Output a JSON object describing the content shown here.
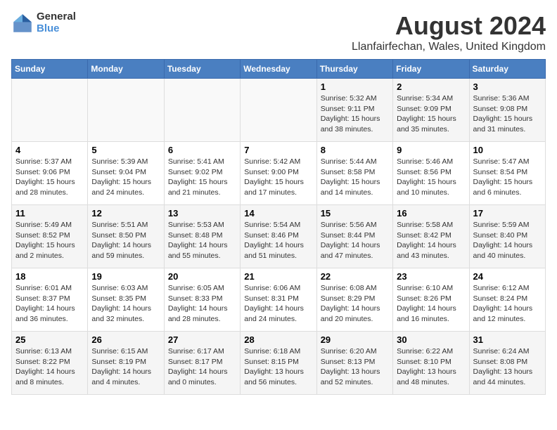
{
  "logo": {
    "general": "General",
    "blue": "Blue"
  },
  "title": "August 2024",
  "subtitle": "Llanfairfechan, Wales, United Kingdom",
  "days_of_week": [
    "Sunday",
    "Monday",
    "Tuesday",
    "Wednesday",
    "Thursday",
    "Friday",
    "Saturday"
  ],
  "weeks": [
    [
      {
        "day": "",
        "info": ""
      },
      {
        "day": "",
        "info": ""
      },
      {
        "day": "",
        "info": ""
      },
      {
        "day": "",
        "info": ""
      },
      {
        "day": "1",
        "info": "Sunrise: 5:32 AM\nSunset: 9:11 PM\nDaylight: 15 hours\nand 38 minutes."
      },
      {
        "day": "2",
        "info": "Sunrise: 5:34 AM\nSunset: 9:09 PM\nDaylight: 15 hours\nand 35 minutes."
      },
      {
        "day": "3",
        "info": "Sunrise: 5:36 AM\nSunset: 9:08 PM\nDaylight: 15 hours\nand 31 minutes."
      }
    ],
    [
      {
        "day": "4",
        "info": "Sunrise: 5:37 AM\nSunset: 9:06 PM\nDaylight: 15 hours\nand 28 minutes."
      },
      {
        "day": "5",
        "info": "Sunrise: 5:39 AM\nSunset: 9:04 PM\nDaylight: 15 hours\nand 24 minutes."
      },
      {
        "day": "6",
        "info": "Sunrise: 5:41 AM\nSunset: 9:02 PM\nDaylight: 15 hours\nand 21 minutes."
      },
      {
        "day": "7",
        "info": "Sunrise: 5:42 AM\nSunset: 9:00 PM\nDaylight: 15 hours\nand 17 minutes."
      },
      {
        "day": "8",
        "info": "Sunrise: 5:44 AM\nSunset: 8:58 PM\nDaylight: 15 hours\nand 14 minutes."
      },
      {
        "day": "9",
        "info": "Sunrise: 5:46 AM\nSunset: 8:56 PM\nDaylight: 15 hours\nand 10 minutes."
      },
      {
        "day": "10",
        "info": "Sunrise: 5:47 AM\nSunset: 8:54 PM\nDaylight: 15 hours\nand 6 minutes."
      }
    ],
    [
      {
        "day": "11",
        "info": "Sunrise: 5:49 AM\nSunset: 8:52 PM\nDaylight: 15 hours\nand 2 minutes."
      },
      {
        "day": "12",
        "info": "Sunrise: 5:51 AM\nSunset: 8:50 PM\nDaylight: 14 hours\nand 59 minutes."
      },
      {
        "day": "13",
        "info": "Sunrise: 5:53 AM\nSunset: 8:48 PM\nDaylight: 14 hours\nand 55 minutes."
      },
      {
        "day": "14",
        "info": "Sunrise: 5:54 AM\nSunset: 8:46 PM\nDaylight: 14 hours\nand 51 minutes."
      },
      {
        "day": "15",
        "info": "Sunrise: 5:56 AM\nSunset: 8:44 PM\nDaylight: 14 hours\nand 47 minutes."
      },
      {
        "day": "16",
        "info": "Sunrise: 5:58 AM\nSunset: 8:42 PM\nDaylight: 14 hours\nand 43 minutes."
      },
      {
        "day": "17",
        "info": "Sunrise: 5:59 AM\nSunset: 8:40 PM\nDaylight: 14 hours\nand 40 minutes."
      }
    ],
    [
      {
        "day": "18",
        "info": "Sunrise: 6:01 AM\nSunset: 8:37 PM\nDaylight: 14 hours\nand 36 minutes."
      },
      {
        "day": "19",
        "info": "Sunrise: 6:03 AM\nSunset: 8:35 PM\nDaylight: 14 hours\nand 32 minutes."
      },
      {
        "day": "20",
        "info": "Sunrise: 6:05 AM\nSunset: 8:33 PM\nDaylight: 14 hours\nand 28 minutes."
      },
      {
        "day": "21",
        "info": "Sunrise: 6:06 AM\nSunset: 8:31 PM\nDaylight: 14 hours\nand 24 minutes."
      },
      {
        "day": "22",
        "info": "Sunrise: 6:08 AM\nSunset: 8:29 PM\nDaylight: 14 hours\nand 20 minutes."
      },
      {
        "day": "23",
        "info": "Sunrise: 6:10 AM\nSunset: 8:26 PM\nDaylight: 14 hours\nand 16 minutes."
      },
      {
        "day": "24",
        "info": "Sunrise: 6:12 AM\nSunset: 8:24 PM\nDaylight: 14 hours\nand 12 minutes."
      }
    ],
    [
      {
        "day": "25",
        "info": "Sunrise: 6:13 AM\nSunset: 8:22 PM\nDaylight: 14 hours\nand 8 minutes."
      },
      {
        "day": "26",
        "info": "Sunrise: 6:15 AM\nSunset: 8:19 PM\nDaylight: 14 hours\nand 4 minutes."
      },
      {
        "day": "27",
        "info": "Sunrise: 6:17 AM\nSunset: 8:17 PM\nDaylight: 14 hours\nand 0 minutes."
      },
      {
        "day": "28",
        "info": "Sunrise: 6:18 AM\nSunset: 8:15 PM\nDaylight: 13 hours\nand 56 minutes."
      },
      {
        "day": "29",
        "info": "Sunrise: 6:20 AM\nSunset: 8:13 PM\nDaylight: 13 hours\nand 52 minutes."
      },
      {
        "day": "30",
        "info": "Sunrise: 6:22 AM\nSunset: 8:10 PM\nDaylight: 13 hours\nand 48 minutes."
      },
      {
        "day": "31",
        "info": "Sunrise: 6:24 AM\nSunset: 8:08 PM\nDaylight: 13 hours\nand 44 minutes."
      }
    ]
  ]
}
